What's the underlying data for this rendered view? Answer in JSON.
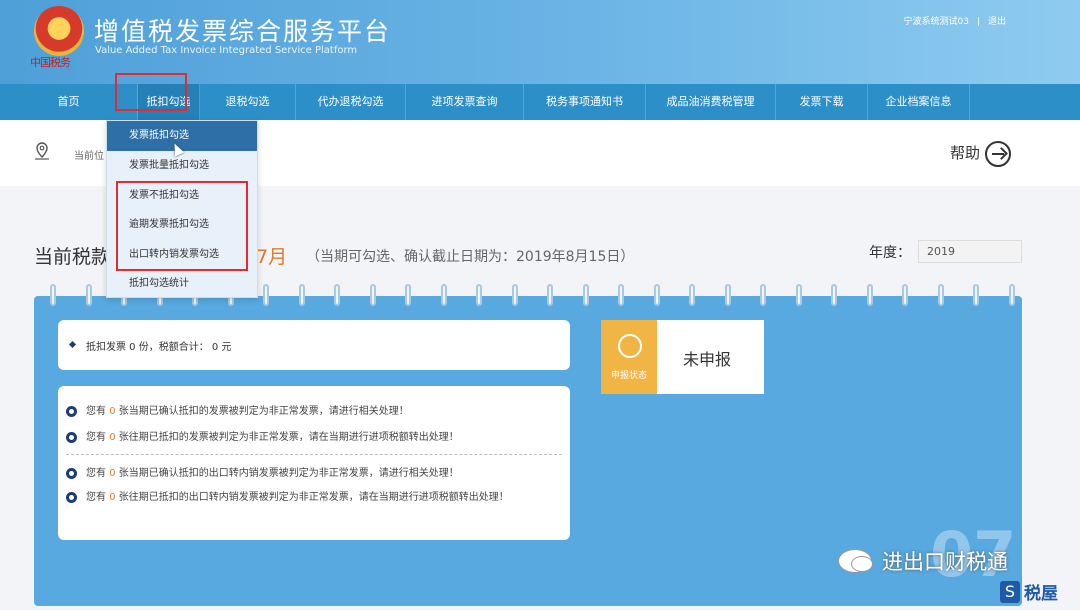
{
  "header": {
    "logo_caption": "中国税务",
    "title_cn": "增值税发票综合服务平台",
    "title_en": "Value Added Tax Invoice Integrated Service Platform",
    "user": "宁波系统测试03",
    "separator": "|",
    "logout": "退出"
  },
  "nav": {
    "items": [
      {
        "label": "首页"
      },
      {
        "label": "抵扣勾选"
      },
      {
        "label": "退税勾选"
      },
      {
        "label": "代办退税勾选"
      },
      {
        "label": "进项发票查询"
      },
      {
        "label": "税务事项通知书"
      },
      {
        "label": "成品油消费税管理"
      },
      {
        "label": "发票下载"
      },
      {
        "label": "企业档案信息"
      }
    ]
  },
  "dropdown": {
    "items": [
      {
        "label": "发票抵扣勾选"
      },
      {
        "label": "发票批量抵扣勾选"
      },
      {
        "label": "发票不抵扣勾选"
      },
      {
        "label": "逾期发票抵扣勾选"
      },
      {
        "label": "出口转内销发票勾选"
      },
      {
        "label": "抵扣勾选统计"
      }
    ]
  },
  "breadcrumb": {
    "prefix": "当前位"
  },
  "help": {
    "label": "帮助"
  },
  "period": {
    "title": "当前税款",
    "month": "7月",
    "note": "（当期可勾选、确认截止日期为：2019年8月15日）",
    "year_label": "年度：",
    "year_value": "2019"
  },
  "summary": {
    "text": "抵扣发票 0 份，税额合计： 0 元"
  },
  "status": {
    "label": "申报状态",
    "value": "未申报"
  },
  "notices": [
    {
      "pre": "您有 ",
      "num": "0",
      "post": " 张当期已确认抵扣的发票被判定为非正常发票，请进行相关处理！"
    },
    {
      "pre": "您有 ",
      "num": "0",
      "post": " 张往期已抵扣的发票被判定为非正常发票，请在当期进行进项税额转出处理！"
    },
    {
      "pre": "您有 ",
      "num": "0",
      "post": " 张当期已确认抵扣的出口转内销发票被判定为非正常发票，请进行相关处理！"
    },
    {
      "pre": "您有 ",
      "num": "0",
      "post": " 张往期已抵扣的出口转内销发票被判定为非正常发票，请在当期进行进项税额转出处理！"
    }
  ],
  "big_number": "07",
  "watermark": {
    "wechat_name": "进出口财税通",
    "brand": "税屋",
    "brand_logo": "S"
  },
  "colors": {
    "nav_bg": "#2d8fc8",
    "panel_bg": "#58a9e0",
    "highlight_red": "#e42b2b",
    "status_orange": "#f0b545",
    "accent_orange": "#e07a2a"
  }
}
